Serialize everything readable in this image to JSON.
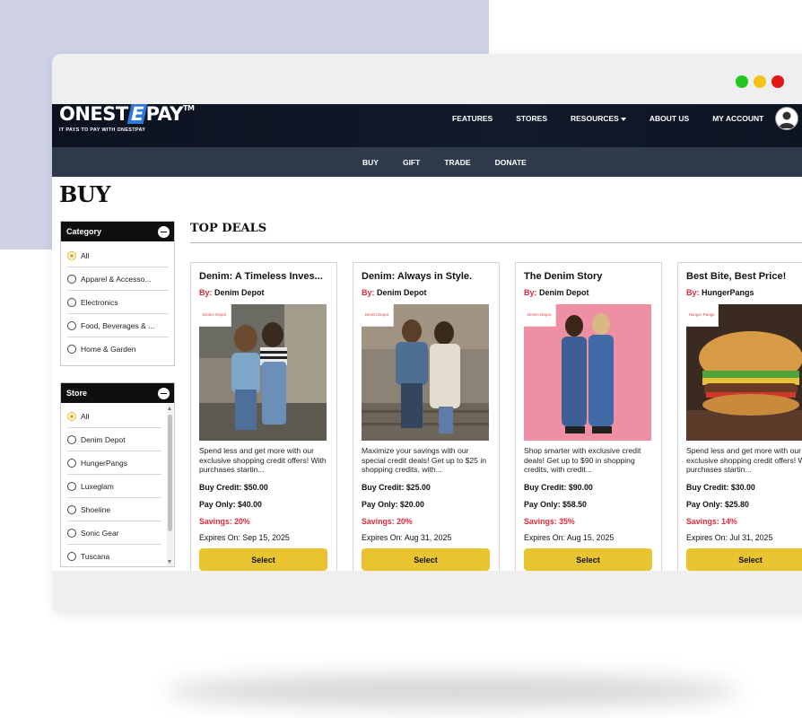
{
  "window": {
    "dots": [
      "#22c71e",
      "#f3c318",
      "#e31515"
    ]
  },
  "header": {
    "logo_text_a": "ONEST",
    "logo_text_e": "E",
    "logo_text_b": "PAY",
    "logo_tm": "TM",
    "tagline": "IT PAYS TO PAY WITH ONESTPAY",
    "nav": [
      "FEATURES",
      "STORES",
      "RESOURCES",
      "ABOUT US",
      "MY ACCOUNT"
    ]
  },
  "subnav": [
    "BUY",
    "GIFT",
    "TRADE",
    "DONATE"
  ],
  "page": {
    "title": "BUY",
    "deals_title": "TOP DEALS"
  },
  "filters": {
    "category": {
      "title": "Category",
      "options": [
        "All",
        "Apparel & Accesso...",
        "Electronics",
        "Food, Beverages & ...",
        "Home & Garden"
      ],
      "selected": "All"
    },
    "store": {
      "title": "Store",
      "options": [
        "All",
        "Denim Depot",
        "HungerPangs",
        "Luxeglam",
        "Shoeline",
        "Sonic Gear",
        "Tuscana"
      ],
      "selected": "All"
    }
  },
  "deals": [
    {
      "title": "Denim: A Timeless Inves...",
      "by_label": "By:",
      "store": "Denim Depot",
      "badge": "Denim Depot",
      "description": "Spend less and get more with our exclusive shopping credit offers! With purchases startin...",
      "buy_credit": "Buy Credit: $50.00",
      "pay_only": "Pay Only: $40.00",
      "savings": "Savings: 20%",
      "expires": "Expires On: Sep 15, 2025",
      "button": "Select"
    },
    {
      "title": "Denim: Always in Style.",
      "by_label": "By:",
      "store": "Denim Depot",
      "badge": "Denim Depot",
      "description": "Maximize your savings with our special credit deals! Get up to $25 in shopping credits, with...",
      "buy_credit": "Buy Credit: $25.00",
      "pay_only": "Pay Only: $20.00",
      "savings": "Savings: 20%",
      "expires": "Expires On: Aug 31, 2025",
      "button": "Select"
    },
    {
      "title": "The Denim Story",
      "by_label": "By:",
      "store": "Denim Depot",
      "badge": "Denim Depot",
      "description": "Shop smarter with exclusive credit deals! Get up to $90 in shopping credits, with credit...",
      "buy_credit": "Buy Credit: $90.00",
      "pay_only": "Pay Only: $58.50",
      "savings": "Savings: 35%",
      "expires": "Expires On: Aug 15, 2025",
      "button": "Select"
    },
    {
      "title": "Best Bite, Best Price!",
      "by_label": "By:",
      "store": "HungerPangs",
      "badge": "Hunger Pangs",
      "description": "Spend less and get more with our exclusive shopping credit offers! With purchases startin...",
      "buy_credit": "Buy Credit: $30.00",
      "pay_only": "Pay Only: $25.80",
      "savings": "Savings: 14%",
      "expires": "Expires On: Jul 31, 2025",
      "button": "Select"
    }
  ]
}
